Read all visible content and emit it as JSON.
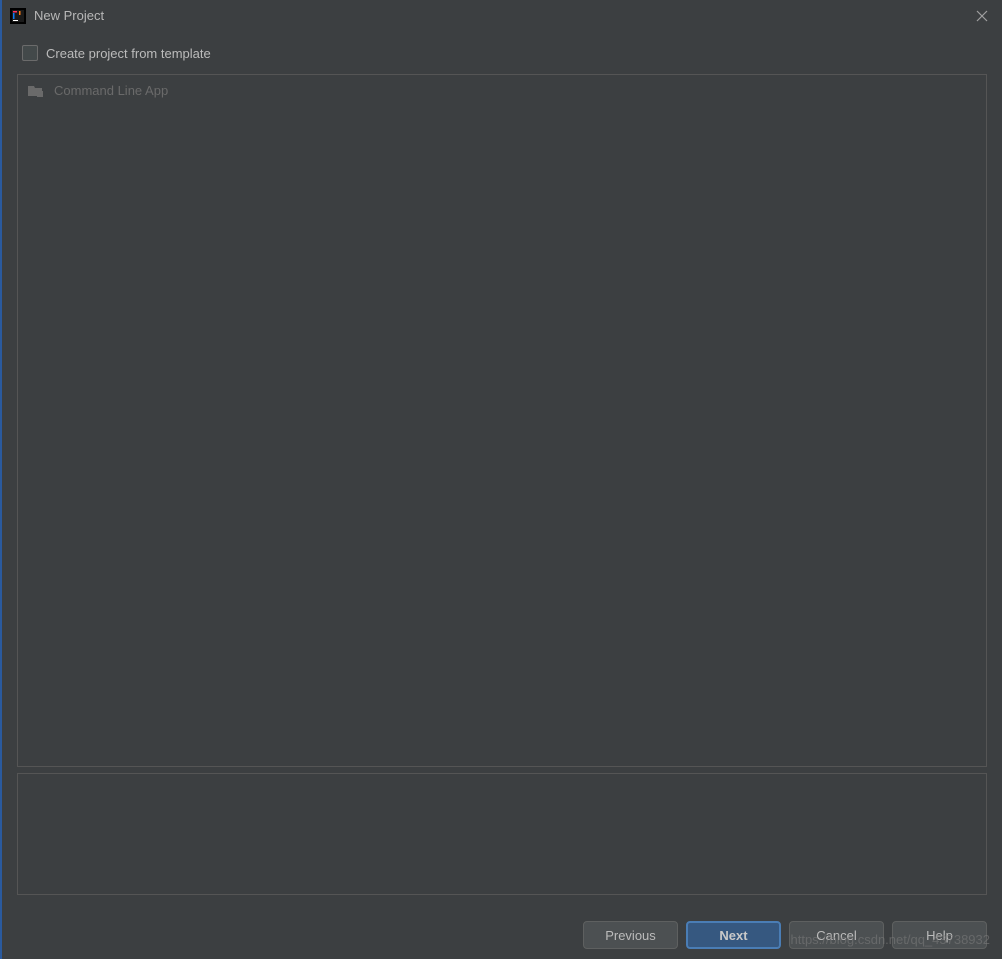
{
  "titlebar": {
    "title": "New Project"
  },
  "checkbox": {
    "label": "Create project from template",
    "checked": false
  },
  "templates": {
    "items": [
      {
        "label": "Command Line App"
      }
    ]
  },
  "buttons": {
    "previous": "Previous",
    "next": "Next",
    "cancel": "Cancel",
    "help": "Help"
  },
  "watermark": "https://blog.csdn.net/qq_43738932"
}
